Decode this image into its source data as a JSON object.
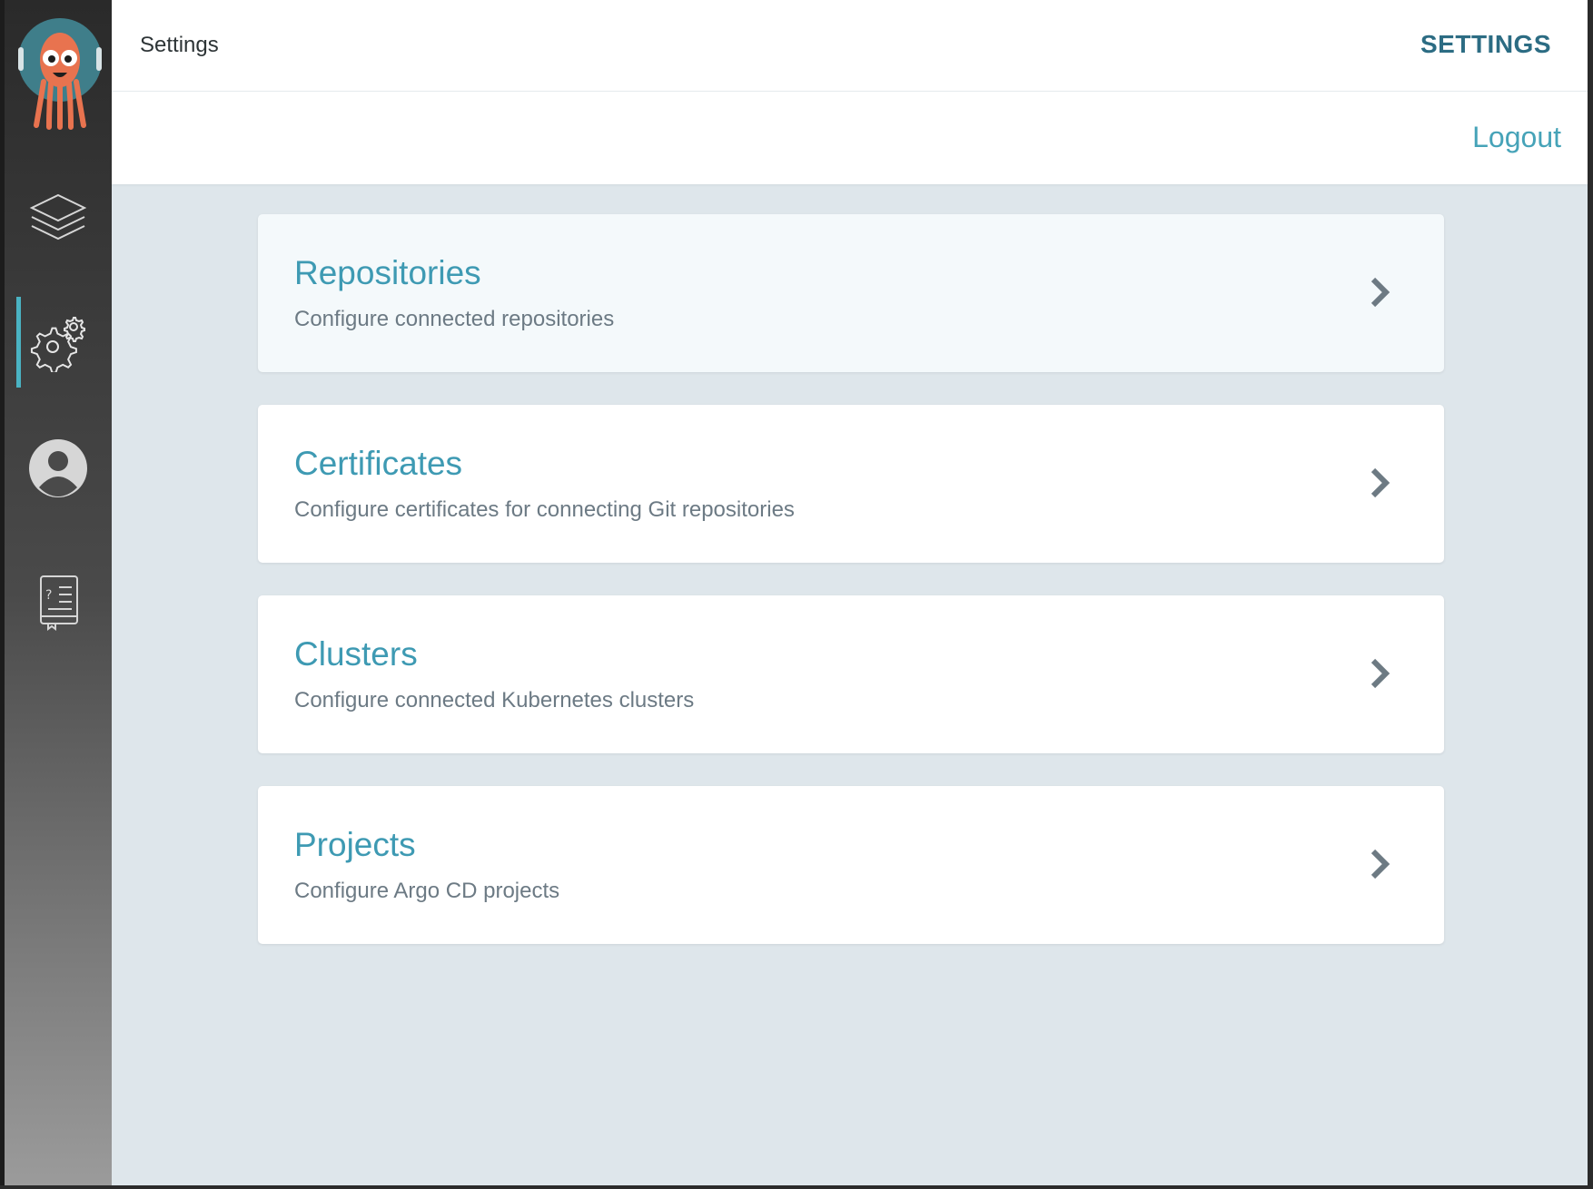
{
  "app": {
    "page_title": "Settings",
    "top_action": "SETTINGS",
    "logout_label": "Logout",
    "accent_color": "#3e9ab3"
  },
  "sidebar": {
    "items": [
      {
        "icon": "layers-icon",
        "label": "Applications",
        "active": false
      },
      {
        "icon": "gear-icon",
        "label": "Settings",
        "active": true
      },
      {
        "icon": "user-icon",
        "label": "User Info",
        "active": false
      },
      {
        "icon": "docs-icon",
        "label": "Documentation",
        "active": false
      }
    ]
  },
  "cards": [
    {
      "title": "Repositories",
      "description": "Configure connected repositories"
    },
    {
      "title": "Certificates",
      "description": "Configure certificates for connecting Git repositories"
    },
    {
      "title": "Clusters",
      "description": "Configure connected Kubernetes clusters"
    },
    {
      "title": "Projects",
      "description": "Configure Argo CD projects"
    }
  ]
}
